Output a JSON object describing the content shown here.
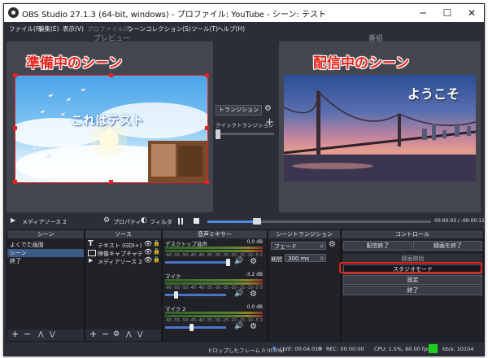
{
  "window": {
    "title": "OBS Studio 27.1.3 (64-bit, windows) - プロファイル: YouTube - シーン: テスト",
    "controls": {
      "minimize": "─",
      "maximize": "☐",
      "close": "✕"
    }
  },
  "menu": {
    "file": "ファイル(F)",
    "edit": "編集(E)",
    "view": "表示(V)",
    "profile": "プロファイル(P)",
    "scenecollection": "シーンコレクション(S)",
    "tools": "ツール(T)",
    "help": "ヘルプ(H)"
  },
  "preview": {
    "label": "プレビュー",
    "annotation": "準備中のシーン",
    "overlay_text": "これはテスト"
  },
  "program": {
    "label": "番組",
    "annotation": "配信中のシーン",
    "overlay_text": "ようこそ"
  },
  "transition_center": {
    "button": "トランジション",
    "quick": "クイックトランジション",
    "add": "+"
  },
  "mediabar": {
    "source_name": "メディアソース 2",
    "properties": "プロパティ",
    "filters": "フィルタ",
    "time": "00:00:03 / -00:00:11",
    "progress": 0.22
  },
  "scenes": {
    "title": "シーン",
    "items": [
      "よくでた画面",
      "シーン",
      "終了"
    ],
    "selected_index": 1
  },
  "sources": {
    "title": "ソース",
    "items": [
      {
        "icon": "text-icon",
        "label": "テキスト (GDI+)"
      },
      {
        "icon": "camera-icon",
        "label": "映像キャプチャデバイス"
      },
      {
        "icon": "play-icon",
        "label": "メディアソース 2"
      }
    ]
  },
  "mixer": {
    "title": "音声ミキサー",
    "tracks": [
      {
        "name": "デスクトップ音声",
        "db": "0.0 dB",
        "level": 0.0
      },
      {
        "name": "マイク",
        "db": "-3.2 dB",
        "level": 0.86
      },
      {
        "name": "マイク 2",
        "db": "0.0 dB",
        "level": 0.6
      }
    ],
    "scale": [
      "-60",
      "-55",
      "-50",
      "-45",
      "-40",
      "-35",
      "-30",
      "-25",
      "-20",
      "-15",
      "-10",
      "-5",
      "0"
    ]
  },
  "scene_transitions": {
    "title": "シーントランジション",
    "type": "フェード",
    "duration_label": "期間",
    "duration_value": "300 ms"
  },
  "controls": {
    "title": "コントロール",
    "stop_stream": "配信終了",
    "stop_recording": "録画を終了",
    "start_recording": "録画開始",
    "studio_mode": "スタジオモード",
    "settings": "設定",
    "exit": "終了"
  },
  "statusbar": {
    "dropped": "ドロップしたフレーム 0 (0.0%)",
    "live": "LIVE: 00:04:01",
    "rec": "REC: 00:00:00",
    "cpu": "CPU: 1.5%, 60.00 fps",
    "kbps": "kb/s: 10104"
  },
  "colors": {
    "accent_red": "#e8231a",
    "status_green": "#1ed01e",
    "bg": "#2b2e38"
  }
}
